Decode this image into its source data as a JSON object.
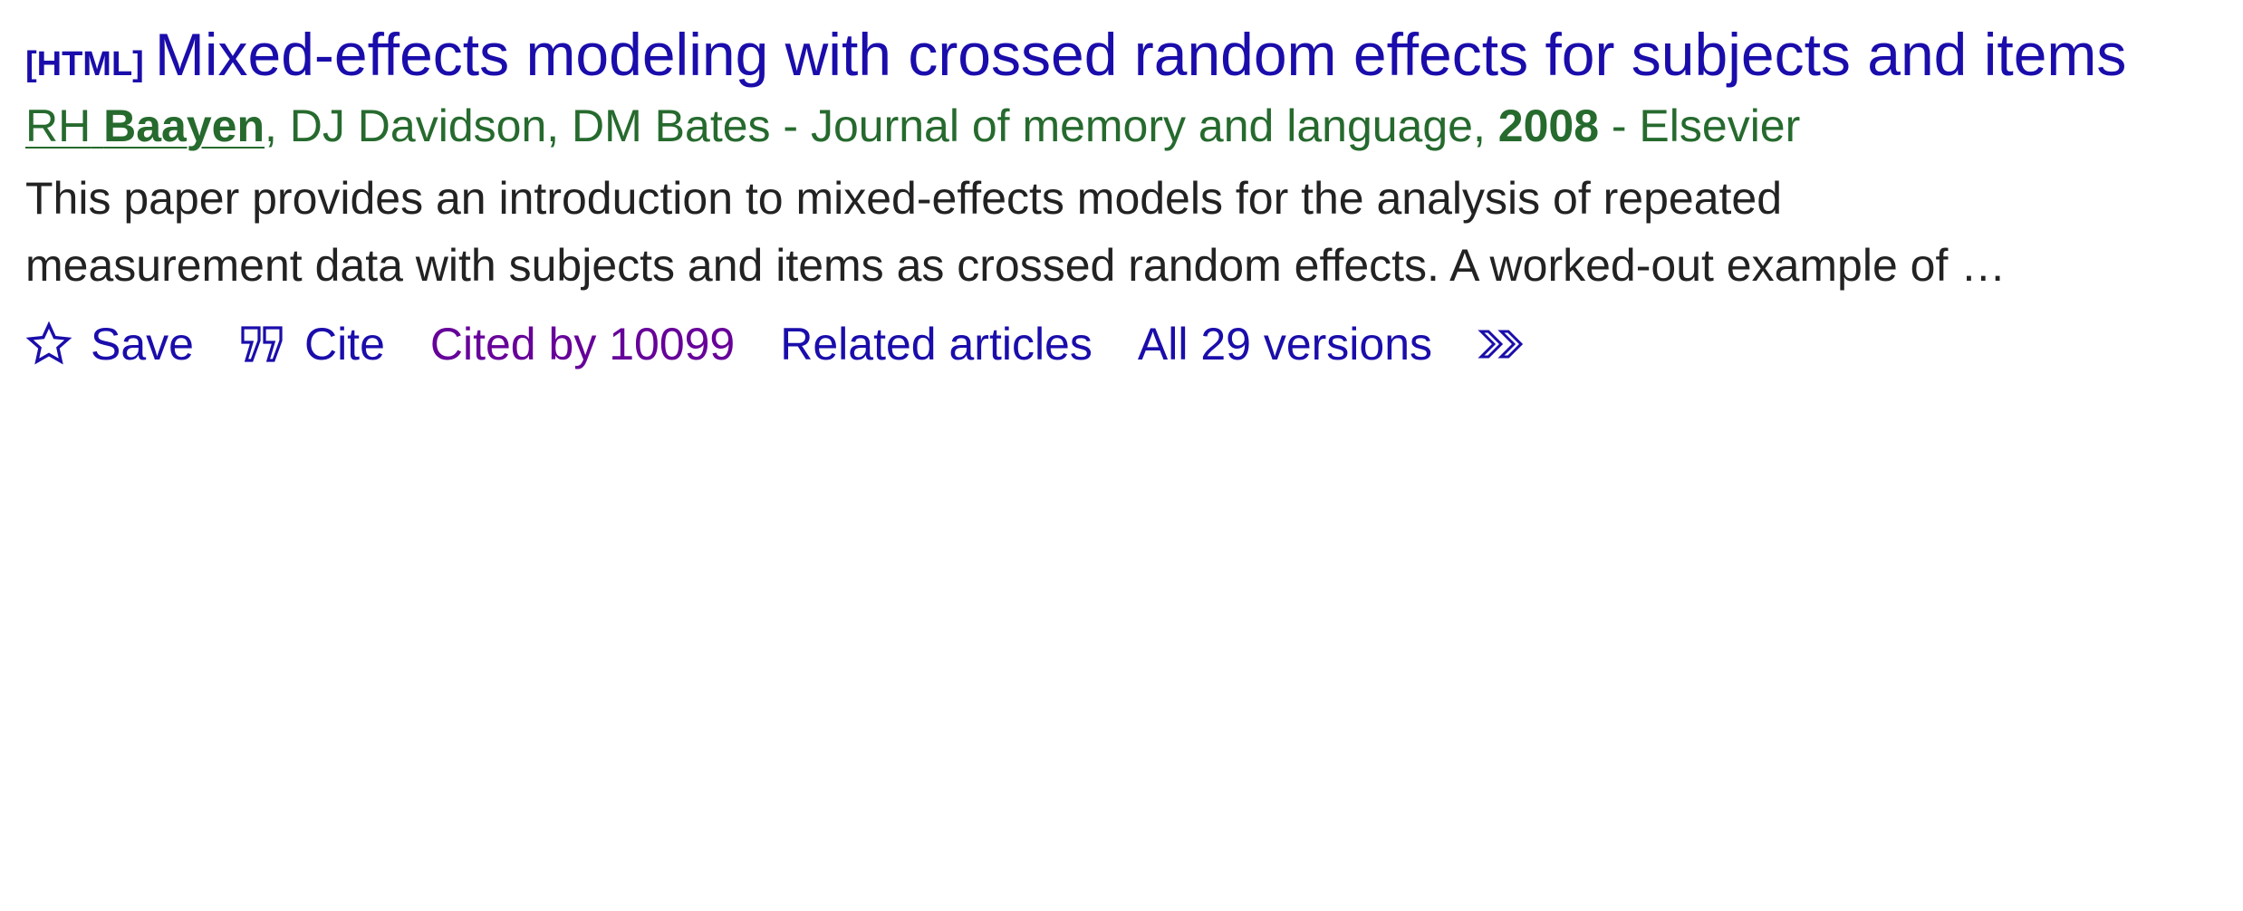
{
  "result": {
    "format_tag": "[HTML]",
    "title": "Mixed-effects modeling with crossed random effects for subjects and items",
    "authors": {
      "first_initials": "RH",
      "first_surname": "Baayen",
      "rest": ", DJ Davidson, DM Bates - Journal of memory and language, ",
      "year": "2008",
      "publisher": " - Elsevier"
    },
    "snippet_line1": "This paper provides an introduction to mixed-effects models for the analysis of repeated",
    "snippet_line2": "measurement data with subjects and items as crossed random effects. A worked-out example of …",
    "actions": {
      "save": "Save",
      "cite": "Cite",
      "cited_by": "Cited by 10099",
      "related": "Related articles",
      "versions": "All 29 versions"
    }
  },
  "colors": {
    "link": "#1a0dab",
    "visited": "#660099",
    "green": "#266a2e",
    "text": "#222222"
  },
  "icons": [
    "star-icon",
    "quote-icon",
    "more-icon"
  ]
}
